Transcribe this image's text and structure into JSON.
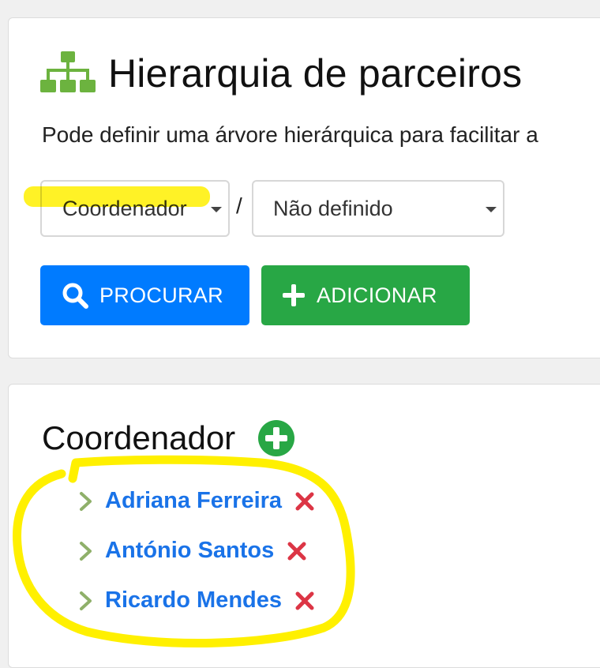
{
  "header": {
    "icon": "sitemap-icon",
    "title": "Hierarquia de parceiros",
    "subtitle": "Pode definir uma árvore hierárquica para facilitar a"
  },
  "filters": {
    "role_select": {
      "value": "Coordenador",
      "icon": "caret-down-icon"
    },
    "separator": "/",
    "parent_select": {
      "value": "Não definido",
      "icon": "caret-down-icon"
    }
  },
  "actions": {
    "search_label": "PROCURAR",
    "add_label": "ADICIONAR"
  },
  "section": {
    "title": "Coordenador",
    "add_icon": "plus-circle-icon",
    "partners": [
      {
        "name": "Adriana Ferreira"
      },
      {
        "name": "António Santos"
      },
      {
        "name": "Ricardo Mendes"
      }
    ]
  },
  "colors": {
    "primary": "#007bff",
    "success": "#28a745",
    "link": "#1a73e8",
    "danger": "#dc3545",
    "icon_green": "#5cb85c",
    "highlight": "#fff000"
  }
}
